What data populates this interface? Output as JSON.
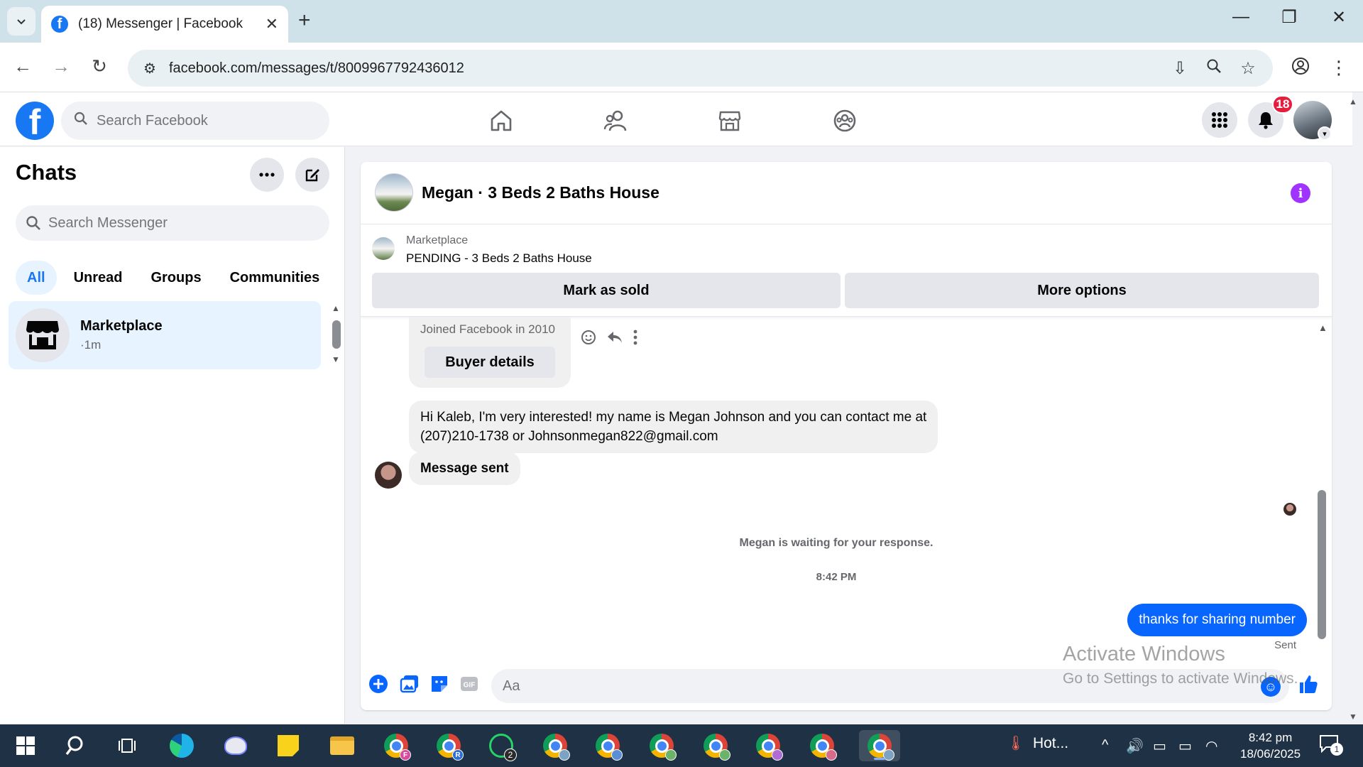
{
  "browser": {
    "tab_title": "(18) Messenger | Facebook",
    "url": "facebook.com/messages/t/8009967792436012"
  },
  "fb_header": {
    "logo_letter": "f",
    "search_placeholder": "Search Facebook",
    "notification_count": "18"
  },
  "sidebar": {
    "title": "Chats",
    "search_placeholder": "Search Messenger",
    "filters": [
      "All",
      "Unread",
      "Groups",
      "Communities"
    ],
    "active_filter": "All",
    "chats": [
      {
        "name": "Marketplace",
        "time": "·1m"
      }
    ]
  },
  "conversation": {
    "title": "Megan · 3 Beds 2 Baths House",
    "marketplace_label": "Marketplace",
    "listing_status": "PENDING - 3 Beds 2 Baths House",
    "mark_sold_label": "Mark as sold",
    "more_options_label": "More options",
    "buyer_card": {
      "joined": "Joined Facebook in 2010",
      "button": "Buyer details"
    },
    "messages": [
      {
        "direction": "in",
        "lines": [
          "Hi Kaleb, I'm very interested! my name is Megan Johnson and you can contact me at",
          "(207)210-1738 or Johnsonmegan822@gmail.com"
        ]
      },
      {
        "direction": "in",
        "text": "Message sent"
      },
      {
        "direction": "out",
        "text": "thanks for sharing number"
      }
    ],
    "waiting_text": "Megan is waiting for your response.",
    "timestamp": "8:42 PM",
    "sent_status": "Sent",
    "composer_placeholder": "Aa"
  },
  "watermark": {
    "line1": "Activate Windows",
    "line2": "Go to Settings to activate Windows."
  },
  "taskbar": {
    "weather": "Hot...",
    "whatsapp_badge": "2",
    "time": "8:42 pm",
    "date": "18/06/2025",
    "notification_count": "1"
  },
  "colors": {
    "fb_blue": "#1877f2",
    "messenger_blue": "#0866ff",
    "badge_red": "#e41e3f",
    "info_purple": "#a033ff"
  }
}
